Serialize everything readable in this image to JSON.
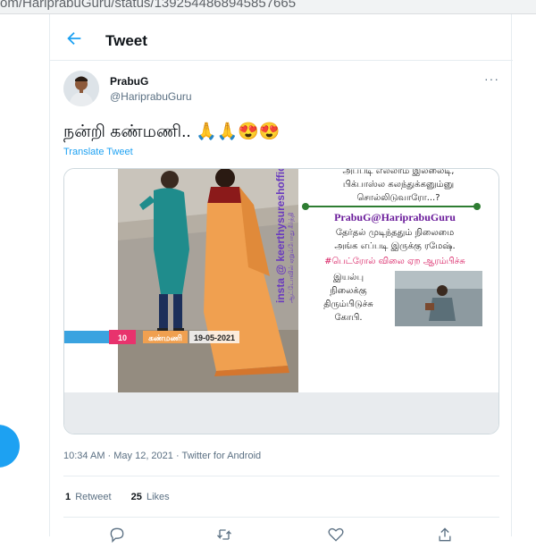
{
  "browser": {
    "url_fragment": "om/HariprabuGuru/status/1392544868945857665"
  },
  "header": {
    "back_icon": "arrow-left-icon",
    "title": "Tweet"
  },
  "tweet": {
    "author_name": "PrabuG",
    "author_handle": "@HariprabuGuru",
    "text": "நன்றி கண்மணி.. 🙏🙏😍😍",
    "translate_label": "Translate Tweet",
    "timestamp": "10:34 AM · May 12, 2021 · Twitter for Android",
    "retweet_count": "1",
    "retweet_label": "Retweet",
    "like_count": "25",
    "like_label": "Likes"
  },
  "meme": {
    "photo_watermark": "insta @ keerthysureshofficial",
    "photo_watermark_small": "ஆட்டோவில் ஏறும்போது கீர்த்தி",
    "tag_number": "10",
    "tag_text": "கண்மணி",
    "tag_date": "19-05-2021",
    "line_top1": "அப்படி எல்லாம் இல்லைடி,",
    "line_top2": "பிக்பாஸ்ல கலந்துக்கனும்னு",
    "line_top3": "சொல்லிடுவாரோ...?",
    "signature": "PrabuG@HariprabuGuru",
    "line_mid1": "தேர்தல் முடிந்ததும் நிலைமை",
    "line_mid2": "அங்க எப்படி இருக்கு ரமேஷ்.",
    "line_hashtag": "#பெட்ரோல் விலை ஏற ஆரம்பிச்சு",
    "line_bot1": "இயல்பு",
    "line_bot2": "நிலைக்கு",
    "line_bot3": "திரும்பிடுச்சு",
    "line_bot4": "கோபி."
  },
  "colors": {
    "accent": "#1da1f2",
    "text_secondary": "#5b7083",
    "saree": "#f0a050",
    "tag_pink": "#e8336d",
    "tag_blue": "#3aa3e0",
    "signature": "#6a1b9a",
    "hashtag": "#d81b60",
    "green_line": "#2e7d32"
  }
}
